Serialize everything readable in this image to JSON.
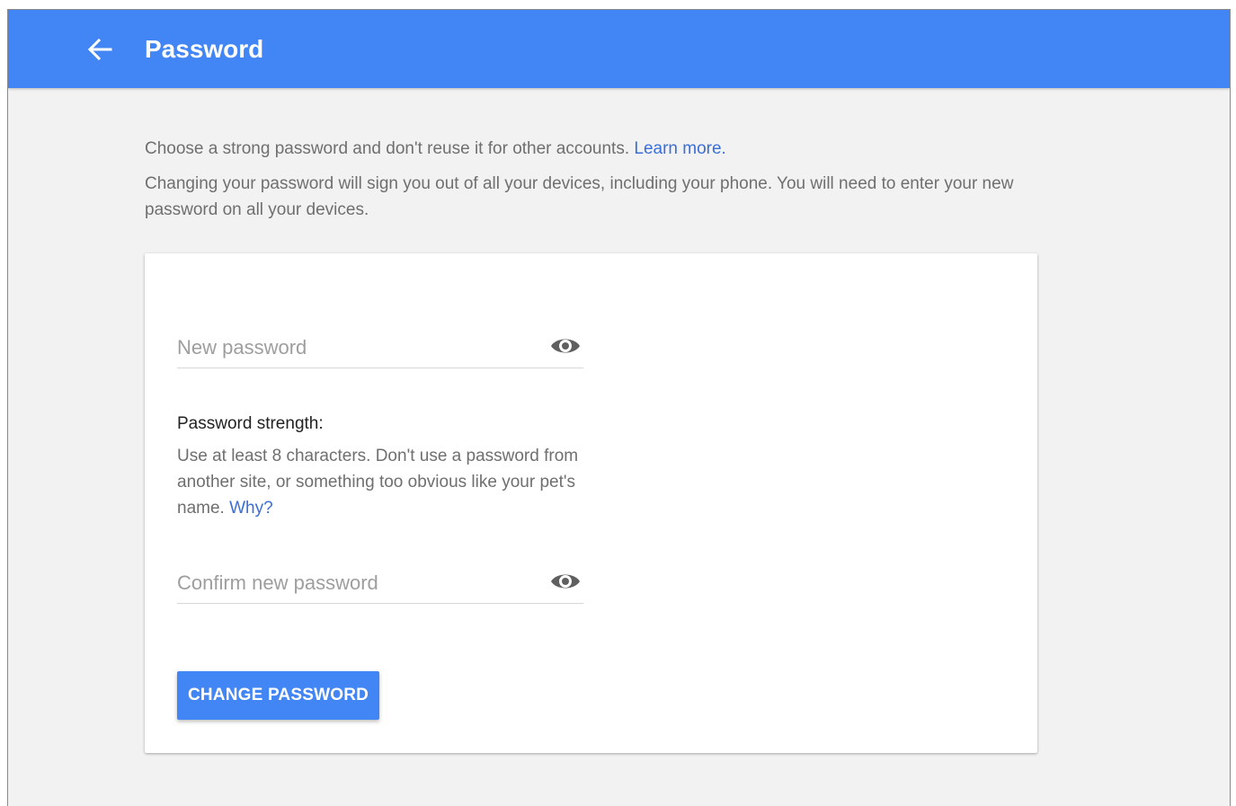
{
  "header": {
    "title": "Password",
    "back_icon": "arrow-back-icon",
    "bg_color": "#4285f4"
  },
  "intro": {
    "line1_text": "Choose a strong password and don't reuse it for other accounts. ",
    "learn_more": "Learn more.",
    "line2_text": "Changing your password will sign you out of all your devices, including your phone. You will need to enter your new password on all your devices."
  },
  "form": {
    "new_password": {
      "value": "",
      "placeholder": "New password",
      "toggle_icon": "eye-icon"
    },
    "strength": {
      "title": "Password strength:",
      "description": "Use at least 8 characters. Don't use a password from another site, or something too obvious like your pet's name. ",
      "why_link": "Why?"
    },
    "confirm_password": {
      "value": "",
      "placeholder": "Confirm new password",
      "toggle_icon": "eye-icon"
    },
    "submit_label": "CHANGE PASSWORD"
  },
  "colors": {
    "accent": "#4285f4",
    "link": "#3a6fd8",
    "background": "#f2f2f2"
  }
}
